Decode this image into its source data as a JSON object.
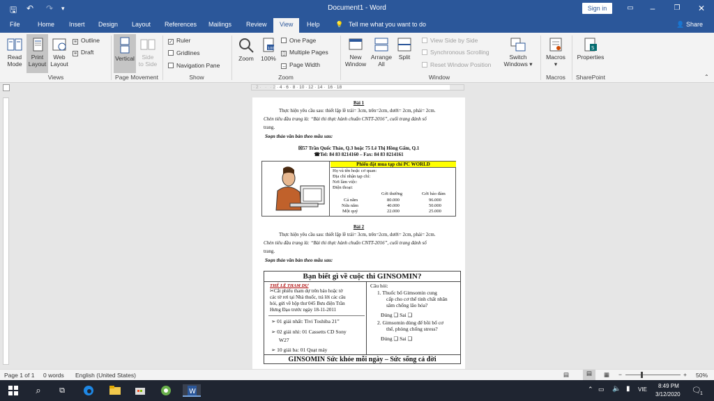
{
  "window": {
    "title": "Document1 - Word",
    "signin": "Sign in"
  },
  "qat": {
    "save": "🖫",
    "undo": "↶",
    "redo": "↷"
  },
  "tabs": [
    "File",
    "Home",
    "Insert",
    "Design",
    "Layout",
    "References",
    "Mailings",
    "Review",
    "View",
    "Help"
  ],
  "tellme": "Tell me what you want to do",
  "share": "Share",
  "ribbon": {
    "views": {
      "read": "Read",
      "read2": "Mode",
      "print": "Print",
      "print2": "Layout",
      "web": "Web",
      "web2": "Layout",
      "outline": "Outline",
      "draft": "Draft",
      "label": "Views"
    },
    "movement": {
      "vertical": "Vertical",
      "side": "Side",
      "side2": "to Side",
      "label": "Page Movement"
    },
    "show": {
      "ruler": "Ruler",
      "gridlines": "Gridlines",
      "navpane": "Navigation Pane",
      "label": "Show"
    },
    "zoom": {
      "zoom": "Zoom",
      "pct": "100%",
      "one": "One Page",
      "multi": "Multiple Pages",
      "width": "Page Width",
      "label": "Zoom"
    },
    "window": {
      "new": "New",
      "new2": "Window",
      "arrange": "Arrange",
      "arrange2": "All",
      "split": "Split",
      "sbs": "View Side by Side",
      "sync": "Synchronous Scrolling",
      "reset": "Reset Window Position",
      "switch": "Switch",
      "switch2": "Windows ▾",
      "label": "Window"
    },
    "macros": {
      "macros": "Macros",
      "label": "Macros"
    },
    "sp": {
      "props": "Properties",
      "label": "SharePoint"
    }
  },
  "ruler": {
    "marks": "· 2 ·   ·   · 2 · 4 · 6 · 8 · 10 · 12 · 14 ·  16 · 18"
  },
  "doc": {
    "b1": "Bài 1",
    "p1a": "Thực hiện yêu cầu sau: thiết lập lề trái= 3cm, trên=2cm, dưới= 2cm, phải= 2cm.",
    "p1b": "Chèn tiêu đầu trang là: “Bài thi thực hành chuẩn CNTT-2016”, cuối trang đánh số",
    "p1c": "trang.",
    "s1": "Soạn thảo văn bản  theo mẫu sau:",
    "addr1": "☒57 Trần Quốc Thảo, Q.3 hoặc 75 Lê Thị Hồng Gấm, Q.1",
    "addr2": "☎Tel: 84 83 8214160 – Fax: 84 83 8214161",
    "formtitle": "Phiếu đặt mua tạp chí PC WORLD",
    "f1": "Họ và tên hoặc cơ quan:",
    "f2": "Địa chỉ nhận tạp chí:",
    "f3": "Nơi làm việc:",
    "f4": "Điện thoại:",
    "th1": "Gởi thường",
    "th2": "Gởi bảo đảm",
    "rows": [
      [
        "Cả năm",
        "80.000",
        "96.000"
      ],
      [
        "Nửa năm",
        "40.000",
        "50.000"
      ],
      [
        "Một quý",
        "22.000",
        "25.000"
      ]
    ],
    "b2": "Bài 2",
    "box2title": "Bạn biết gì về cuộc thi GINSOMIN?",
    "rules": "THỂ LỆ THAM DỰ",
    "rulestext1": "✂Cắt phiếu tham dự trên báo hoặc tờ",
    "rulestext2": "các tờ rơi tại Nhà thuốc, trả lời các câu",
    "rulestext3": "hỏi, gửi về hộp thư 045 Bưu điện Trần",
    "rulestext4": "Hưng Đạo trước ngày 18-11-2011",
    "prize1": "➢ 01 giải nhất: Tivi Toshiba 21”",
    "prize2": "➢ 02 giải nhì: 01 Cassetts CD Sony",
    "prize2b": "W27",
    "prize3": "➢ 10 giải ba: 01 Quạt máy",
    "q": "Câu hỏi:",
    "q1a": "1.  Thuốc bổ Gimsomin cung",
    "q1b": "cấp cho cơ thể tinh chất nhân",
    "q1c": "sâm chống lão hóa?",
    "q1ans": "Đúng  ❑      Sai ❑",
    "q2a": "2.  Gimsomin dùng để bồi bổ cơ",
    "q2b": "thể, phòng chống  stress?",
    "q2ans": "Đúng  ❑      Sai ❑",
    "footer": "GINSOMIN Sức khỏe mỗi ngày – Sức sống cả đời"
  },
  "status": {
    "page": "Page 1 of 1",
    "words": "0 words",
    "lang": "English (United States)",
    "zoom": "50%"
  },
  "taskbar": {
    "time": "8:49 PM",
    "date": "3/12/2020",
    "lang": "VIE",
    "notif": "1"
  },
  "colors": {
    "accent": "#2b579a",
    "yellow": "#ffff00"
  }
}
